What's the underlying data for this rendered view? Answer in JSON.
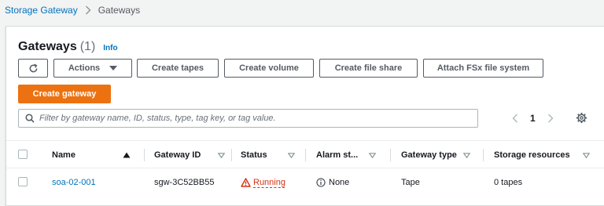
{
  "breadcrumb": {
    "items": [
      "Storage Gateway",
      "Gateways"
    ]
  },
  "header": {
    "title": "Gateways",
    "count": "(1)",
    "info_label": "Info"
  },
  "toolbar": {
    "actions_label": "Actions",
    "create_tapes_label": "Create tapes",
    "create_volume_label": "Create volume",
    "create_file_share_label": "Create file share",
    "attach_fsx_label": "Attach FSx file system",
    "create_gateway_label": "Create gateway"
  },
  "search": {
    "placeholder": "Filter by gateway name, ID, status, type, tag key, or tag value."
  },
  "pagination": {
    "current_page": "1"
  },
  "table": {
    "columns": [
      "Name",
      "Gateway ID",
      "Status",
      "Alarm st...",
      "Gateway type",
      "Storage resources"
    ],
    "rows": [
      {
        "name": "soa-02-001",
        "gateway_id": "sgw-3C52BB55",
        "status": "Running",
        "alarm_state": "None",
        "gateway_type": "Tape",
        "storage_resources": "0 tapes"
      }
    ]
  },
  "colors": {
    "link": "#0073bb",
    "primary": "#ec7211",
    "error": "#d13212"
  }
}
